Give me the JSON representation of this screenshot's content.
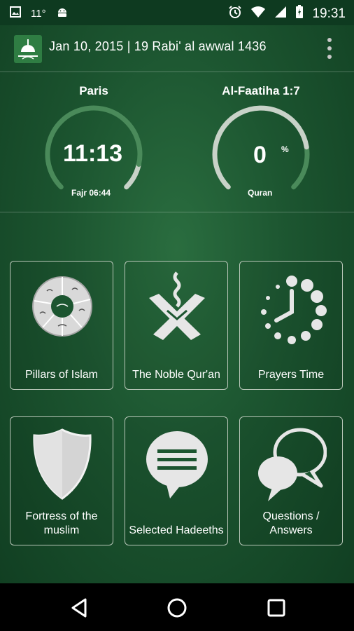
{
  "status_bar": {
    "temperature": "11°",
    "time": "19:31"
  },
  "header": {
    "date": "Jan 10, 2015 | 19 Rabi' al awwal 1436"
  },
  "prayer_gauge": {
    "city": "Paris",
    "time_remaining": "11:13",
    "next_prayer": "Fajr 06:44",
    "progress": 0.88
  },
  "quran_gauge": {
    "surah": "Al-Faatiha 1:7",
    "percent": "0",
    "percent_sign": "%",
    "label": "Quran",
    "progress": 0.8
  },
  "tiles": [
    {
      "label": "Pillars of Islam",
      "icon": "pillars-wheel-icon"
    },
    {
      "label": "The Noble Qur'an",
      "icon": "quran-stand-icon"
    },
    {
      "label": "Prayers Time",
      "icon": "clock-dots-icon"
    },
    {
      "label": "Fortress of the muslim",
      "icon": "shield-icon"
    },
    {
      "label": "Selected Hadeeths",
      "icon": "speech-bubble-lines-icon"
    },
    {
      "label": "Questions / Answers",
      "icon": "chat-bubbles-icon"
    }
  ],
  "colors": {
    "background": "#1c5530",
    "status_bar": "#0e3a20",
    "gauge_active": "#4a8a5a",
    "gauge_track": "#c8d2c8"
  }
}
